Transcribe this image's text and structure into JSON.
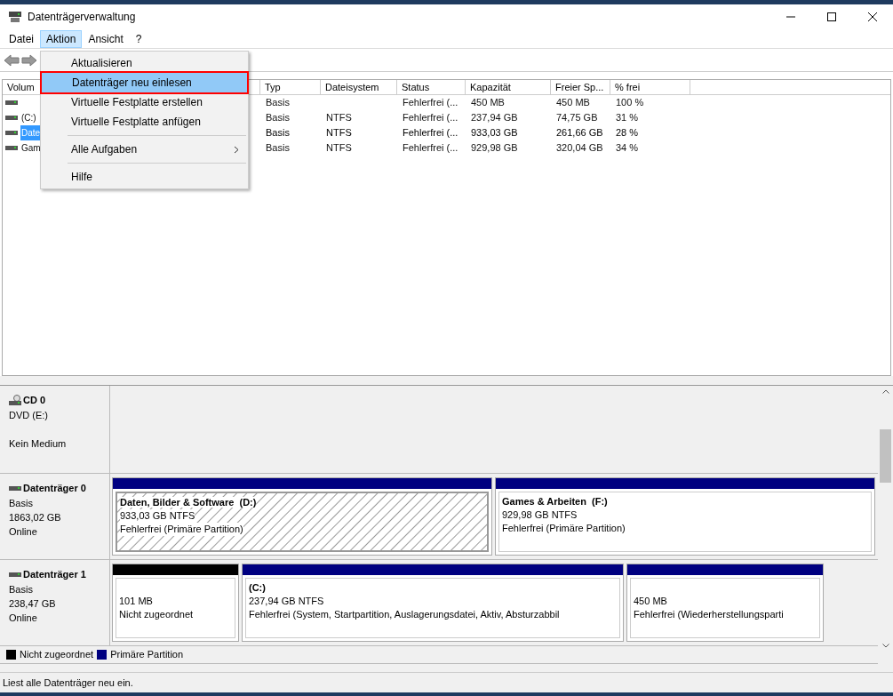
{
  "window": {
    "title": "Datenträgerverwaltung"
  },
  "menu": [
    {
      "label": "Datei",
      "selected": false
    },
    {
      "label": "Aktion",
      "selected": true
    },
    {
      "label": "Ansicht",
      "selected": false
    },
    {
      "label": "?",
      "selected": false
    }
  ],
  "dropdown": [
    {
      "kind": "item",
      "label": "Aktualisieren",
      "selected": false
    },
    {
      "kind": "item",
      "label": "Datenträger neu einlesen",
      "selected": true
    },
    {
      "kind": "item",
      "label": "Virtuelle Festplatte erstellen",
      "selected": false
    },
    {
      "kind": "item",
      "label": "Virtuelle Festplatte anfügen",
      "selected": false
    },
    {
      "kind": "separator"
    },
    {
      "kind": "submenu",
      "label": "Alle Aufgaben",
      "selected": false
    },
    {
      "kind": "separator"
    },
    {
      "kind": "item",
      "label": "Hilfe",
      "selected": false
    }
  ],
  "table": {
    "columns": [
      "Volum",
      "Typ",
      "Dateisystem",
      "Status",
      "Kapazität",
      "Freier Sp...",
      "% frei"
    ],
    "rows": [
      {
        "selected": false,
        "cells": [
          "",
          "Basis",
          "",
          "Fehlerfrei (...",
          "450 MB",
          "450 MB",
          "100 %"
        ]
      },
      {
        "selected": false,
        "cells": [
          "(C:)",
          "Basis",
          "NTFS",
          "Fehlerfrei (...",
          "237,94 GB",
          "74,75 GB",
          "31 %"
        ]
      },
      {
        "selected": true,
        "cells": [
          "Date",
          "Basis",
          "NTFS",
          "Fehlerfrei (...",
          "933,03 GB",
          "261,66 GB",
          "28 %"
        ]
      },
      {
        "selected": false,
        "cells": [
          "Gam",
          "Basis",
          "NTFS",
          "Fehlerfrei (...",
          "929,98 GB",
          "320,04 GB",
          "34 %"
        ]
      }
    ]
  },
  "disks": [
    {
      "kind": "cd",
      "name": "CD 0",
      "lines": [
        "DVD (E:)",
        "Kein Medium"
      ]
    },
    {
      "kind": "disk",
      "name": "Datenträger 0",
      "lines": [
        "Basis",
        "1863,02 GB",
        "Online"
      ],
      "partitions": [
        {
          "kind": "primary",
          "selected": true,
          "title": "Daten, Bilder & Software  (D:)",
          "lines": [
            "933,03 GB NTFS",
            "Fehlerfrei (Primäre Partition)"
          ]
        },
        {
          "kind": "primary",
          "selected": false,
          "title": "Games & Arbeiten  (F:)",
          "lines": [
            "929,98 GB NTFS",
            "Fehlerfrei (Primäre Partition)"
          ]
        }
      ]
    },
    {
      "kind": "disk",
      "name": "Datenträger 1",
      "lines": [
        "Basis",
        "238,47 GB",
        "Online"
      ],
      "partitions": [
        {
          "kind": "unallocated",
          "selected": false,
          "lines": [
            "101 MB",
            "Nicht zugeordnet"
          ]
        },
        {
          "kind": "primary",
          "selected": false,
          "title": "(C:)",
          "lines": [
            "237,94 GB NTFS",
            "Fehlerfrei (System, Startpartition, Auslagerungsdatei, Aktiv, Absturzabbil"
          ]
        },
        {
          "kind": "primary",
          "selected": false,
          "lines": [
            "450 MB",
            "Fehlerfrei (Wiederherstellungsparti"
          ]
        }
      ]
    }
  ],
  "legend": [
    {
      "label": "Nicht zugeordnet",
      "color": "#000000"
    },
    {
      "label": "Primäre Partition",
      "color": "#000080"
    }
  ],
  "status_bar": {
    "text": "Liest alle Datenträger neu ein."
  }
}
